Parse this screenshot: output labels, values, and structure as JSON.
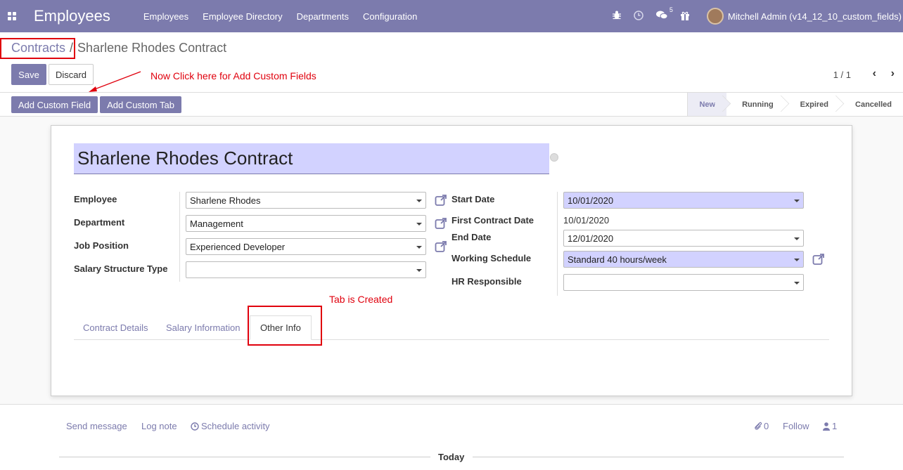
{
  "navbar": {
    "app_name": "Employees",
    "menu": [
      "Employees",
      "Employee Directory",
      "Departments",
      "Configuration"
    ],
    "chat_badge": "5",
    "user": "Mitchell Admin (v14_12_10_custom_fields)"
  },
  "breadcrumb": {
    "parent": "Contracts",
    "separator": "/",
    "current": "Sharlene Rhodes Contract"
  },
  "buttons": {
    "save": "Save",
    "discard": "Discard",
    "add_custom_field": "Add Custom Field",
    "add_custom_tab": "Add Custom Tab"
  },
  "annotations": {
    "custom_fields_note": "Now Click here for Add Custom Fields",
    "tab_note": "Tab is Created",
    "color": "#e0000d"
  },
  "pager": {
    "value": "1 / 1"
  },
  "statusbar": [
    "New",
    "Running",
    "Expired",
    "Cancelled"
  ],
  "form": {
    "title": "Sharlene Rhodes Contract",
    "left": {
      "employee_label": "Employee",
      "employee": "Sharlene Rhodes",
      "department_label": "Department",
      "department": "Management",
      "job_label": "Job Position",
      "job": "Experienced Developer",
      "salary_type_label": "Salary Structure Type",
      "salary_type": ""
    },
    "right": {
      "start_label": "Start Date",
      "start": "10/01/2020",
      "first_label": "First Contract Date",
      "first": "10/01/2020",
      "end_label": "End Date",
      "end": "12/01/2020",
      "schedule_label": "Working Schedule",
      "schedule": "Standard 40 hours/week",
      "hr_label": "HR Responsible",
      "hr": ""
    },
    "tabs": [
      "Contract Details",
      "Salary Information",
      "Other Info"
    ]
  },
  "chatter": {
    "send_message": "Send message",
    "log_note": "Log note",
    "schedule_activity": "Schedule activity",
    "attachments": "0",
    "follow": "Follow",
    "followers": "1",
    "today": "Today"
  },
  "colors": {
    "brand": "#7c7bad",
    "required_field": "#d2d2ff"
  }
}
